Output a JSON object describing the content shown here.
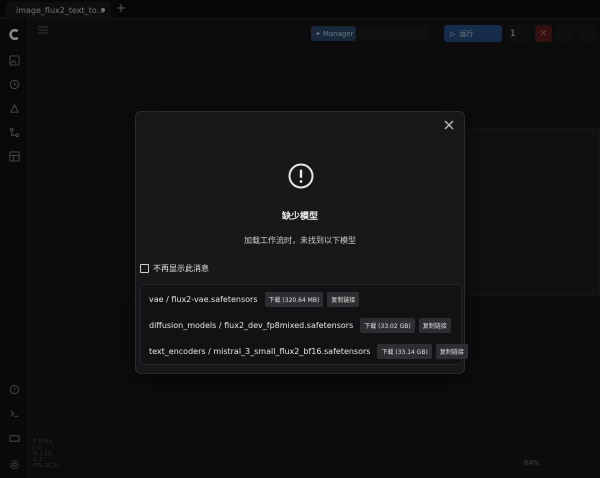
{
  "tab": {
    "title": "image_flux2_text_to..."
  },
  "toolbar": {
    "manager_label": "Manager",
    "run_label": "运行",
    "queue_count": "1"
  },
  "stats": [
    "T: 0.00s",
    "I: 0",
    "N: 1 [1]",
    "V: 1",
    "FPS:18.20"
  ],
  "canvas": {
    "zoom": "64%"
  },
  "dialog": {
    "title": "缺少模型",
    "subtitle": "加载工作流时，未找到以下模型",
    "checkbox_label": "不再显示此消息",
    "models": [
      {
        "name": "vae / flux2-vae.safetensors",
        "download": "下载 (320.64 MB)",
        "copy": "复制链接"
      },
      {
        "name": "diffusion_models / flux2_dev_fp8mixed.safetensors",
        "download": "下载 (33.02 GB)",
        "copy": "复制链接"
      },
      {
        "name": "text_encoders / mistral_3_small_flux2_bf16.safetensors",
        "download": "下载 (33.14 GB)",
        "copy": "复制链接"
      }
    ]
  },
  "colors": {
    "accent": "#2b4f87",
    "dialog_bg": "#18181b",
    "button_bg": "#2e2e32"
  }
}
